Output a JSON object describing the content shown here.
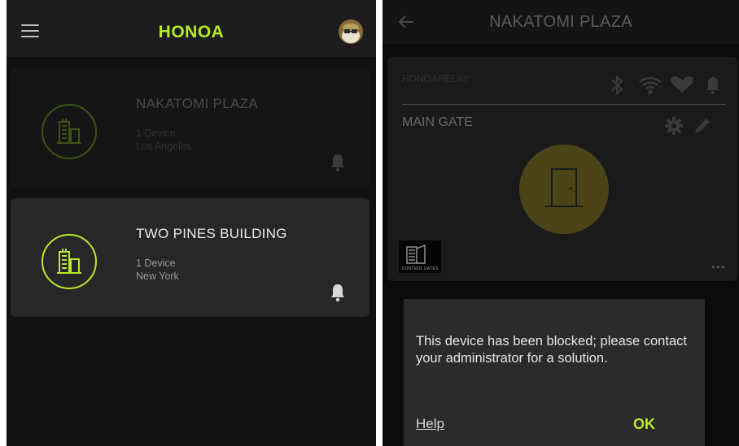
{
  "home": {
    "app_title": "HONOA",
    "menu_icon": "hamburger-menu-icon",
    "avatar_icon": "user-avatar-icon",
    "locations": [
      {
        "name": "NAKATOMI PLAZA",
        "devices": "1 Device",
        "city": "Los Angeles",
        "icon": "building-icon",
        "alert_icon": "bell-icon",
        "state": "dimmed"
      },
      {
        "name": "TWO PINES BUILDING",
        "devices": "1 Device",
        "city": "New York",
        "icon": "building-icon",
        "alert_icon": "bell-icon",
        "state": "active"
      }
    ]
  },
  "detail": {
    "title": "NAKATOMI PLAZA",
    "back_icon": "back-arrow-icon",
    "relay_label": "HONOARELAY",
    "status_icons": [
      "bluetooth-icon",
      "wifi-icon",
      "heart-icon",
      "bell-icon"
    ],
    "gate_name": "MAIN GATE",
    "gate_tools": [
      "gear-icon",
      "pencil-icon"
    ],
    "door_icon": "door-icon",
    "brand_logo_text": "CONTROL GATES",
    "more_label": "•••"
  },
  "dialog": {
    "message": "This device has been blocked; please contact your administrator for a solution.",
    "help_label": "Help",
    "ok_label": "OK"
  },
  "colors": {
    "accent": "#b8ea2b",
    "door_circle": "#4a4418",
    "background": "#111111"
  }
}
